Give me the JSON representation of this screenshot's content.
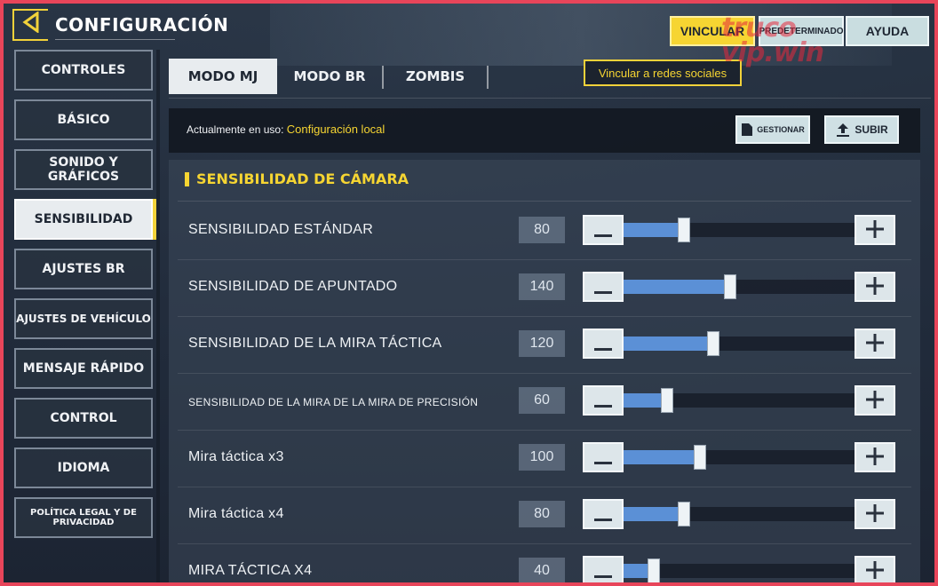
{
  "header": {
    "back_icon": "chevron-left-icon",
    "title": "CONFIGURACIÓN",
    "vincular_label": "VINCULAR",
    "predeterminado_label": "PREDETERMINADO",
    "ayuda_label": "AYUDA",
    "tooltip": "Vincular a redes sociales",
    "watermark_line1": "truco",
    "watermark_line2": "vip.win"
  },
  "sidebar": {
    "items": [
      {
        "label": "CONTROLES"
      },
      {
        "label": "BÁSICO"
      },
      {
        "label": "SONIDO Y GRÁFICOS"
      },
      {
        "label": "SENSIBILIDAD",
        "active": true
      },
      {
        "label": "AJUSTES BR"
      },
      {
        "label": "AJUSTES DE VEHÍCULO"
      },
      {
        "label": "MENSAJE RÁPIDO"
      },
      {
        "label": "CONTROL"
      },
      {
        "label": "IDIOMA"
      },
      {
        "label": "POLÍTICA LEGAL Y DE PRIVACIDAD"
      }
    ]
  },
  "tabs": [
    {
      "label": "MODO MJ",
      "active": true
    },
    {
      "label": "MODO BR"
    },
    {
      "label": "ZOMBIS"
    }
  ],
  "config": {
    "prefix": "Actualmente en uso: ",
    "value": "Configuración local",
    "gestionar_label": "GESTIONAR",
    "subir_label": "SUBIR"
  },
  "section": {
    "title": "SENSIBILIDAD DE CÁMARA",
    "rows": [
      {
        "label": "SENSIBILIDAD ESTÁNDAR",
        "value": "80",
        "fraction": 0.26
      },
      {
        "label": "SENSIBILIDAD DE APUNTADO",
        "value": "140",
        "fraction": 0.46
      },
      {
        "label": "SENSIBILIDAD DE LA MIRA TÁCTICA",
        "value": "120",
        "fraction": 0.39
      },
      {
        "label": "SENSIBILIDAD DE LA MIRA DE LA MIRA DE PRECISIÓN",
        "value": "60",
        "fraction": 0.19,
        "small": true
      },
      {
        "label": "Mira táctica x3",
        "value": "100",
        "fraction": 0.33
      },
      {
        "label": "Mira táctica x4",
        "value": "80",
        "fraction": 0.26
      },
      {
        "label": "MIRA TÁCTICA X4",
        "value": "40",
        "fraction": 0.13
      }
    ]
  },
  "colors": {
    "accent": "#f6d532",
    "slider_fill": "#5b90d6",
    "frame": "#e8455a"
  }
}
